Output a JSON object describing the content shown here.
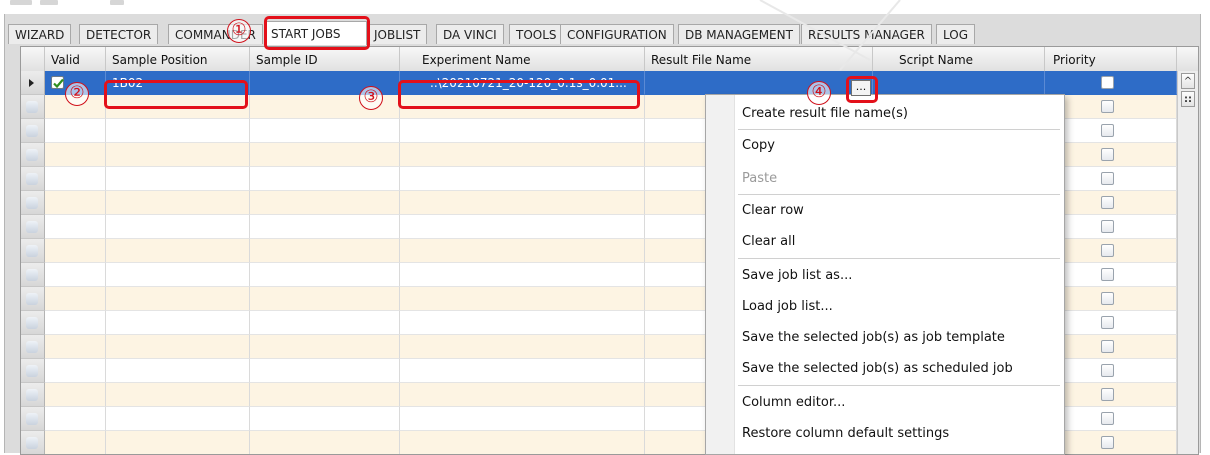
{
  "tabs": [
    {
      "label": "WIZARD"
    },
    {
      "label": "DETECTOR"
    },
    {
      "label": "COMMANDER"
    },
    {
      "label": "START JOBS",
      "active": true
    },
    {
      "label": "JOBLIST"
    },
    {
      "label": "DA VINCI"
    },
    {
      "label": "TOOLS"
    },
    {
      "label": "CONFIGURATION"
    },
    {
      "label": "DB MANAGEMENT"
    },
    {
      "label": "RESULTS MANAGER"
    },
    {
      "label": "LOG"
    }
  ],
  "columns": [
    "Valid",
    "Sample Position",
    "Sample ID",
    "Experiment Name",
    "Result File Name",
    "Script Name",
    "Priority"
  ],
  "rows": [
    {
      "valid": true,
      "sample_position": "1B02",
      "sample_id": "",
      "experiment_name": "..\\20210721_20-120_0.1s_0.01...",
      "result_file_name": "",
      "script_name": "...",
      "priority": false,
      "selected": true
    }
  ],
  "context_menu": {
    "items": [
      {
        "label": "Create result file name(s)",
        "enabled": true
      },
      {
        "label": "Copy",
        "enabled": true
      },
      {
        "label": "Paste",
        "enabled": false
      },
      {
        "label": "Clear row",
        "enabled": true
      },
      {
        "label": "Clear all",
        "enabled": true
      },
      {
        "label": "Save job list as...",
        "enabled": true
      },
      {
        "label": "Load job list...",
        "enabled": true
      },
      {
        "label": "Save the selected job(s) as job template",
        "enabled": true
      },
      {
        "label": "Save the selected job(s) as scheduled job",
        "enabled": true
      },
      {
        "label": "Column editor...",
        "enabled": true
      },
      {
        "label": "Restore column default settings",
        "enabled": true
      }
    ]
  },
  "annotations": [
    "①",
    "②",
    "③",
    "④"
  ],
  "scrollbar": {
    "up": "^",
    "grip": "::"
  },
  "colors": {
    "selection": "#2e6cc7",
    "highlight_red": "#e3101a",
    "alt_row": "#fdf4e3"
  }
}
